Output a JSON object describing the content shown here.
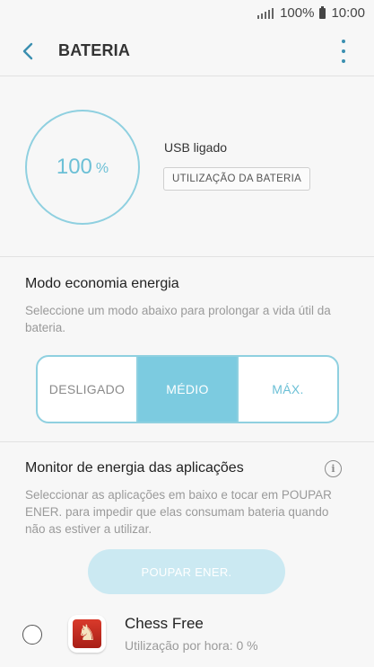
{
  "status_bar": {
    "battery_percent": "100%",
    "time": "10:00",
    "icons": [
      "signal-icon",
      "battery-icon"
    ]
  },
  "app_bar": {
    "title": "BATERIA",
    "icons": [
      "back-arrow-icon",
      "more-vert-icon"
    ]
  },
  "battery": {
    "level_value": "100",
    "level_unit": "%",
    "level_fraction": 1.0,
    "status": "USB ligado",
    "usage_button": "UTILIZAÇÃO DA BATERIA"
  },
  "power_saving": {
    "title": "Modo economia energia",
    "description": "Seleccione um modo abaixo para prolongar a vida útil da bateria.",
    "modes": [
      "DESLIGADO",
      "MÉDIO",
      "MÁX."
    ],
    "selected": "MÉDIO"
  },
  "monitor": {
    "title": "Monitor de energia das aplicações",
    "description": "Seleccionar as aplicações em baixo e tocar em POUPAR ENER. para impedir que elas consumam bateria quando não as estiver a utilizar.",
    "save_button": "POUPAR ENER.",
    "icons": [
      "info-icon"
    ],
    "apps": [
      {
        "name": "Chess Free",
        "usage": "Utilização por hora: 0 %",
        "icon": "chess-knight-icon"
      }
    ]
  },
  "colors": {
    "accent": "#7ccbe0",
    "ring": "#8fd0e0",
    "save_button_disabled": "#cbe9f2",
    "overflow_menu": "#3a8fb0"
  }
}
